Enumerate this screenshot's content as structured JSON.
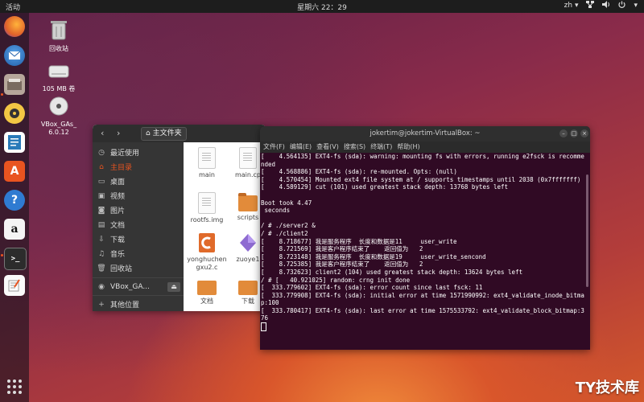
{
  "topbar": {
    "activities": "活动",
    "clock": "星期六 22：29",
    "lang": "zh",
    "lang_arrow": "▾"
  },
  "dock": {
    "items": [
      {
        "name": "firefox-icon"
      },
      {
        "name": "thunderbird-icon"
      },
      {
        "name": "files-icon"
      },
      {
        "name": "rhythmbox-icon"
      },
      {
        "name": "libreoffice-writer-icon"
      },
      {
        "name": "software-center-icon",
        "glyph": "A"
      },
      {
        "name": "help-icon",
        "glyph": "?"
      },
      {
        "name": "amazon-icon",
        "glyph": "a"
      },
      {
        "name": "terminal-icon",
        "glyph": ">_"
      },
      {
        "name": "text-editor-icon"
      }
    ]
  },
  "desktop": {
    "trash_label": "回收站",
    "volume_label": "105 MB 卷",
    "vbox_label": "VBox_GAs_ 6.0.12"
  },
  "files": {
    "path_button": "主文件夹",
    "sidebar": [
      {
        "icon": "◷",
        "label": "最近使用"
      },
      {
        "icon": "⌂",
        "label": "主目录"
      },
      {
        "icon": "▭",
        "label": "桌面"
      },
      {
        "icon": "▣",
        "label": "视频"
      },
      {
        "icon": "◙",
        "label": "图片"
      },
      {
        "icon": "▤",
        "label": "文档"
      },
      {
        "icon": "⇩",
        "label": "下载"
      },
      {
        "icon": "♫",
        "label": "音乐"
      },
      {
        "icon": "🗑",
        "label": "回收站"
      },
      {
        "icon": "◉",
        "label": "VBox_GA..."
      },
      {
        "icon": "+",
        "label": "其他位置"
      }
    ],
    "eject": "⏏",
    "items": [
      {
        "label": "main"
      },
      {
        "label": "main.cp"
      },
      {
        "label": "rootfs.img"
      },
      {
        "label": "scripts"
      },
      {
        "label": "yonghuchen gxu2.c"
      },
      {
        "label": "zuoye1"
      },
      {
        "label": "文档"
      },
      {
        "label": "下载"
      }
    ]
  },
  "terminal": {
    "title": "jokertim@jokertim-VirtualBox: ~",
    "menu": [
      "文件(F)",
      "编辑(E)",
      "查看(V)",
      "搜索(S)",
      "终端(T)",
      "帮助(H)"
    ],
    "lines": [
      "[    4.564135] EXT4-fs (sda): warning: mounting fs with errors, running e2fsck is recommended",
      "[    4.568886] EXT4-fs (sda): re-mounted. Opts: (null)",
      "[    4.570454] Mounted ext4 file system at / supports timestamps until 2038 (0x7fffffff)",
      "[    4.589129] cut (101) used greatest stack depth: 13768 bytes left",
      "",
      "Boot took 4.47",
      " seconds",
      "",
      "/ # ./server2 &",
      "/ # ./client2",
      "[    8.718677] 我是服务程序  长度和数据是11     user_write",
      "[    8.721569] 我是客户程序结束了    返回值为   2",
      "[    8.723148] 我是服务程序  长度和数据是19     user_write_sencond",
      "[    8.725385] 我是客户程序结束了    返回值为   2",
      "[    8.732623] client2 (104) used greatest stack depth: 13624 bytes left",
      "/ # [   40.921025] random: crng init done",
      "[  333.779602] EXT4-fs (sda): error count since last fsck: 11",
      "[  333.779908] EXT4-fs (sda): initial error at time 1571990992: ext4_validate_inode_bitmap:100",
      "[  333.780417] EXT4-fs (sda): last error at time 1575533792: ext4_validate_block_bitmap:376"
    ]
  },
  "watermark": "TY技术库"
}
